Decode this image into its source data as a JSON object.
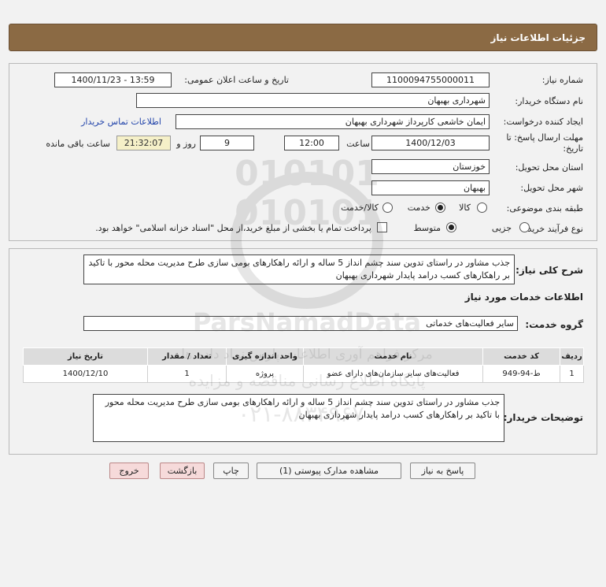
{
  "header": {
    "title": "جزئیات اطلاعات نیاز"
  },
  "need_info": {
    "need_number_label": "شماره نیاز:",
    "need_number": "1100094755000011",
    "announce_label": "تاریخ و ساعت اعلان عمومی:",
    "announce_value": "1400/11/23 - 13:59",
    "buyer_label": "نام دستگاه خریدار:",
    "buyer_value": "شهرداری بهبهان",
    "creator_label": "ایجاد کننده درخواست:",
    "creator_value": "ایمان خاشعی کارپرداز شهرداری بهبهان",
    "contact_link": "اطلاعات تماس خریدار",
    "deadline_label_1": "مهلت ارسال پاسخ: تا",
    "deadline_label_2": "تاریخ:",
    "deadline_date": "1400/12/03",
    "time_label": "ساعت",
    "deadline_time": "12:00",
    "days_value": "9",
    "days_label": "روز و",
    "remaining_time": "21:32:07",
    "remaining_label": "ساعت باقی مانده",
    "province_label": "استان محل تحویل:",
    "province_value": "خوزستان",
    "city_label": "شهر محل تحویل:",
    "city_value": "بهبهان",
    "category_label": "طبقه بندی موضوعی:",
    "category_options": [
      "کالا",
      "خدمت",
      "کالا/خدمت"
    ],
    "category_selected": "خدمت",
    "process_label": "نوع فرآیند خرید :",
    "process_options": [
      "جزیی",
      "متوسط"
    ],
    "process_selected": "متوسط",
    "payment_note": "پرداخت تمام یا بخشی از مبلغ خرید،از محل \"اسناد خزانه اسلامی\" خواهد بود."
  },
  "summary": {
    "label": "شرح کلی نیاز:",
    "text": "جذب مشاور در راستای تدوین سند چشم انداز 5 ساله و ارائه راهکارهای بومی سازی طرح مدیریت محله محور با تاکید بر راهکارهای کسب درامد پایدار شهرداری بهبهان",
    "services_title": "اطلاعات خدمات مورد نیاز",
    "service_group_label": "گروه خدمت:",
    "service_group_value": "سایر فعالیت‌های خدماتی",
    "table_headers": [
      "ردیف",
      "کد خدمت",
      "نام خدمت",
      "واحد اندازه گیری",
      "تعداد / مقدار",
      "تاریخ نیاز"
    ],
    "table_rows": [
      [
        "1",
        "ط-94-949",
        "فعالیت‌های سایر سازمان‌های دارای عضو",
        "پروژه",
        "1",
        "1400/12/10"
      ]
    ],
    "buyer_notes_label": "توضیحات خریدار:",
    "buyer_notes": "جذب مشاور در راستای تدوین سند چشم انداز 5 ساله و ارائه راهکارهای بومی سازی طرح مدیریت محله محور با تاکید بر راهکارهای کسب درامد پایدار شهرداری بهبهان"
  },
  "buttons": {
    "reply": "پاسخ به نیاز",
    "attachments": "مشاهده مدارک پیوستی (1)",
    "print": "چاپ",
    "back": "بازگشت",
    "exit": "خروج"
  },
  "watermark": {
    "digits": "010101",
    "brand": "ParsNamadData",
    "line1": "مرکز فراهم آوری اطلاعات پارس نماد داده ها",
    "line2": "پایگاه اطلاع رسانی مناقصه و مزایده",
    "phone": "۰۲۱-۸۸۳۴۹۶۷۰"
  },
  "colors": {
    "header": "#8b6a44",
    "link": "#2244aa",
    "remaining_bg": "#f5f0c8"
  }
}
